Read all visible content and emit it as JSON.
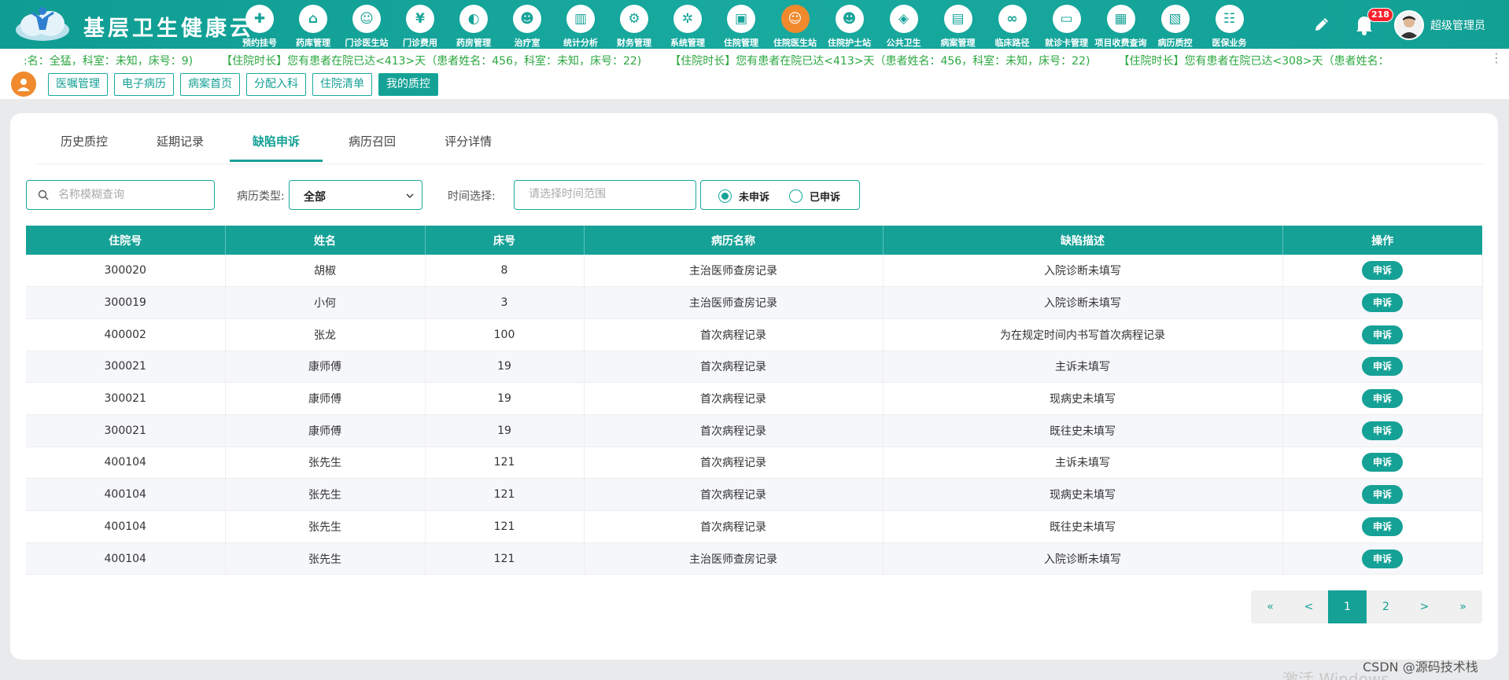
{
  "app": {
    "title": "基层卫生健康云",
    "user_name": "超级管理员",
    "notification_count": "218"
  },
  "nav": [
    {
      "label": "预约挂号",
      "icon": "calendar-icon",
      "glyph": "✚"
    },
    {
      "label": "药库管理",
      "icon": "home-icon",
      "glyph": "⌂"
    },
    {
      "label": "门诊医生站",
      "icon": "doctor-icon",
      "glyph": "☺"
    },
    {
      "label": "门诊费用",
      "icon": "yen-icon",
      "glyph": "¥"
    },
    {
      "label": "药房管理",
      "icon": "pill-icon",
      "glyph": "◐"
    },
    {
      "label": "治疗室",
      "icon": "nurse-icon",
      "glyph": "☻"
    },
    {
      "label": "统计分析",
      "icon": "bar-chart-icon",
      "glyph": "▥"
    },
    {
      "label": "财务管理",
      "icon": "gear-money-icon",
      "glyph": "⚙"
    },
    {
      "label": "系统管理",
      "icon": "settings-icon",
      "glyph": "✲"
    },
    {
      "label": "住院管理",
      "icon": "bed-icon",
      "glyph": "▣"
    },
    {
      "label": "住院医生站",
      "icon": "inpatient-doctor-icon",
      "glyph": "☺"
    },
    {
      "label": "住院护士站",
      "icon": "nurse-station-icon",
      "glyph": "☻"
    },
    {
      "label": "公共卫生",
      "icon": "public-health-icon",
      "glyph": "◈"
    },
    {
      "label": "病案管理",
      "icon": "record-icon",
      "glyph": "▤"
    },
    {
      "label": "临床路径",
      "icon": "path-icon",
      "glyph": "∞"
    },
    {
      "label": "就诊卡管理",
      "icon": "card-icon",
      "glyph": "▭"
    },
    {
      "label": "项目收费查询",
      "icon": "fee-query-icon",
      "glyph": "▦"
    },
    {
      "label": "病历质控",
      "icon": "quality-icon",
      "glyph": "▧"
    },
    {
      "label": "医保业务",
      "icon": "insurance-icon",
      "glyph": "☷"
    }
  ],
  "marquee": [
    ":名：全猛，科室：未知，床号：9)",
    "【住院时长】您有患者在院已达<413>天（患者姓名：456，科室：未知，床号：22)",
    "【住院时长】您有患者在院已达<413>天（患者姓名：456，科室：未知，床号：22)",
    "【住院时长】您有患者在院已达<308>天（患者姓名："
  ],
  "sub_tabs": [
    "医嘱管理",
    "电子病历",
    "病案首页",
    "分配入科",
    "住院清单",
    "我的质控"
  ],
  "tabs": [
    "历史质控",
    "延期记录",
    "缺陷申诉",
    "病历召回",
    "评分详情"
  ],
  "filters": {
    "search_placeholder": "名称模糊查询",
    "type_label": "病历类型:",
    "type_value": "全部",
    "time_label": "时间选择:",
    "time_placeholder": "请选择时间范围",
    "radio_unappealed": "未申诉",
    "radio_appealed": "已申诉"
  },
  "table": {
    "headers": [
      "住院号",
      "姓名",
      "床号",
      "病历名称",
      "缺陷描述",
      "操作"
    ],
    "action_label": "申诉",
    "rows": [
      [
        "300020",
        "胡椒",
        "8",
        "主治医师查房记录",
        "入院诊断未填写"
      ],
      [
        "300019",
        "小何",
        "3",
        "主治医师查房记录",
        "入院诊断未填写"
      ],
      [
        "400002",
        "张龙",
        "100",
        "首次病程记录",
        "为在规定时间内书写首次病程记录"
      ],
      [
        "300021",
        "康师傅",
        "19",
        "首次病程记录",
        "主诉未填写"
      ],
      [
        "300021",
        "康师傅",
        "19",
        "首次病程记录",
        "现病史未填写"
      ],
      [
        "300021",
        "康师傅",
        "19",
        "首次病程记录",
        "既往史未填写"
      ],
      [
        "400104",
        "张先生",
        "121",
        "首次病程记录",
        "主诉未填写"
      ],
      [
        "400104",
        "张先生",
        "121",
        "首次病程记录",
        "现病史未填写"
      ],
      [
        "400104",
        "张先生",
        "121",
        "首次病程记录",
        "既往史未填写"
      ],
      [
        "400104",
        "张先生",
        "121",
        "主治医师查房记录",
        "入院诊断未填写"
      ]
    ]
  },
  "pagination": [
    "«",
    "<",
    "1",
    "2",
    ">",
    "»"
  ],
  "watermark": "CSDN @源码技术栈",
  "os_hint": "激活 Windows",
  "colors": {
    "primary": "#15a196",
    "accent": "#f08a2c",
    "marquee": "#2ba840"
  }
}
